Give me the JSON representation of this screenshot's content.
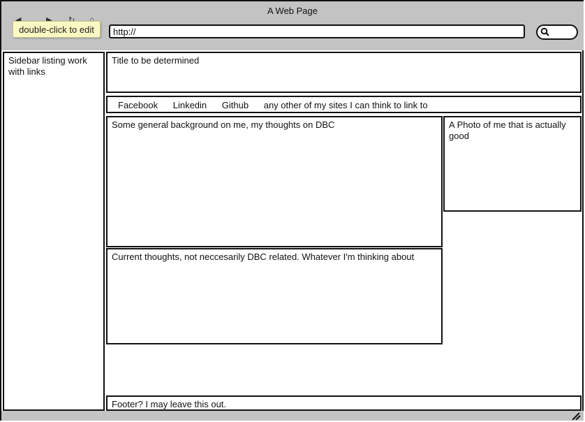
{
  "window": {
    "title": "A Web Page"
  },
  "tooltip": {
    "text": "double-click to edit"
  },
  "address_bar": {
    "value": "http://"
  },
  "icons": {
    "back": "chevron-left-icon",
    "forward": "chevron-right-icon",
    "reload": "reload-icon",
    "home": "home-icon",
    "search": "search-icon",
    "resize": "resize-grip-icon"
  },
  "sidebar": {
    "text": "Sidebar listing work with links"
  },
  "title_box": {
    "text": "Title to be determined"
  },
  "links": {
    "facebook": "Facebook",
    "linkedin": "Linkedin",
    "github": "Github",
    "other": "any other of my sites I can think to link to"
  },
  "background_box": {
    "text": "Some general background on me, my thoughts on DBC"
  },
  "photo_box": {
    "text": "A Photo of me that is actually good"
  },
  "thoughts_box": {
    "text": "Current thoughts, not neccesarily DBC related. Whatever I'm thinking about"
  },
  "footer": {
    "text": "Footer? I may leave this out."
  },
  "colors": {
    "chrome": "#c3c3c3",
    "tooltip_bg": "#fbf9c3",
    "border": "#111111"
  }
}
